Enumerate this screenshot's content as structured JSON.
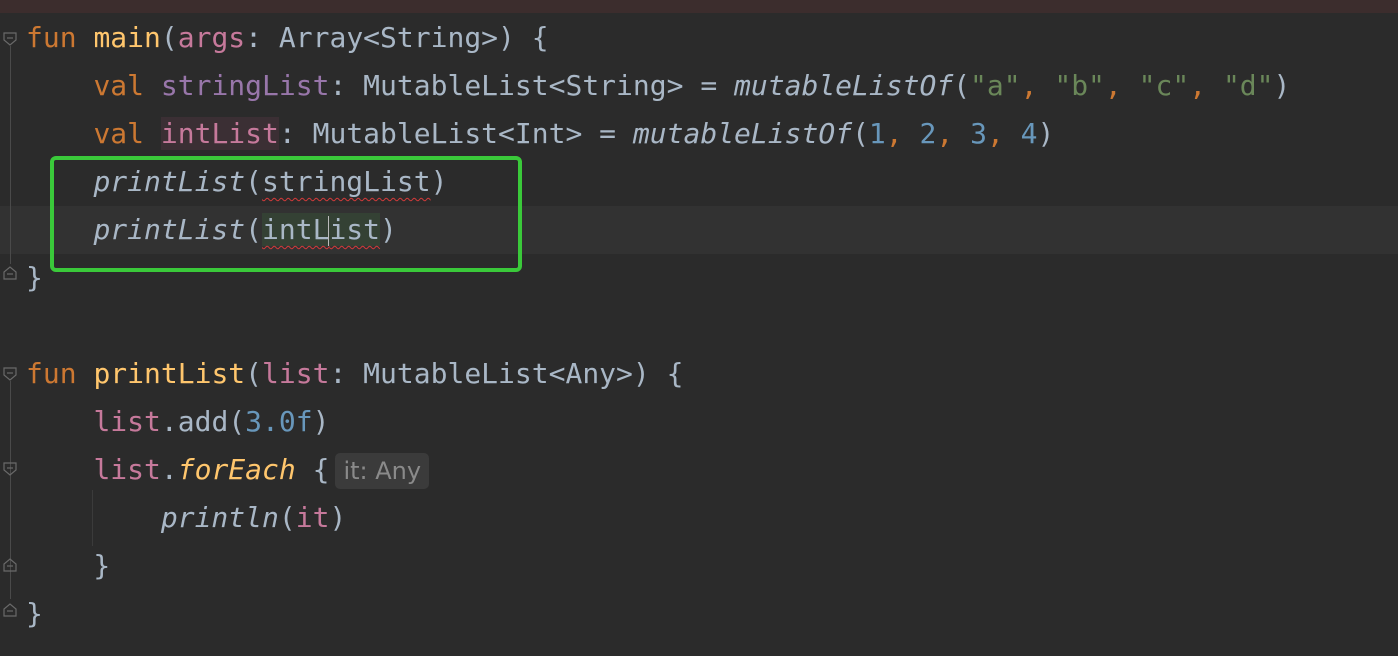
{
  "editor": {
    "lines": [
      {
        "tokens": [
          {
            "t": "fun",
            "c": "kw"
          },
          {
            "t": " ",
            "c": "plain"
          },
          {
            "t": "main",
            "c": "fn"
          },
          {
            "t": "(",
            "c": "plain"
          },
          {
            "t": "args",
            "c": "var"
          },
          {
            "t": ": Array<String>) {",
            "c": "plain"
          }
        ]
      },
      {
        "tokens": [
          {
            "t": "    ",
            "c": "plain"
          },
          {
            "t": "val",
            "c": "kw"
          },
          {
            "t": " ",
            "c": "plain"
          },
          {
            "t": "stringList",
            "c": "var2"
          },
          {
            "t": ": MutableList<String> = ",
            "c": "plain"
          },
          {
            "t": "mutableListOf",
            "c": "ital-fn"
          },
          {
            "t": "(",
            "c": "plain"
          },
          {
            "t": "\"a\"",
            "c": "str"
          },
          {
            "t": ", ",
            "c": "kw"
          },
          {
            "t": "\"b\"",
            "c": "str"
          },
          {
            "t": ", ",
            "c": "kw"
          },
          {
            "t": "\"c\"",
            "c": "str"
          },
          {
            "t": ", ",
            "c": "kw"
          },
          {
            "t": "\"d\"",
            "c": "str"
          },
          {
            "t": ")",
            "c": "plain"
          }
        ]
      },
      {
        "tokens": [
          {
            "t": "    ",
            "c": "plain"
          },
          {
            "t": "val",
            "c": "kw"
          },
          {
            "t": " ",
            "c": "plain"
          },
          {
            "t": "intList",
            "c": "pvar-bg"
          },
          {
            "t": ": MutableList<Int> = ",
            "c": "plain"
          },
          {
            "t": "mutableListOf",
            "c": "ital-fn"
          },
          {
            "t": "(",
            "c": "plain"
          },
          {
            "t": "1",
            "c": "num"
          },
          {
            "t": ", ",
            "c": "kw"
          },
          {
            "t": "2",
            "c": "num"
          },
          {
            "t": ", ",
            "c": "kw"
          },
          {
            "t": "3",
            "c": "num"
          },
          {
            "t": ", ",
            "c": "kw"
          },
          {
            "t": "4",
            "c": "num"
          },
          {
            "t": ")",
            "c": "plain"
          }
        ]
      },
      {
        "tokens": [
          {
            "t": "    ",
            "c": "plain"
          },
          {
            "t": "printList",
            "c": "ital-fn"
          },
          {
            "t": "(",
            "c": "plain"
          },
          {
            "t": "stringList",
            "c": "squiggle"
          },
          {
            "t": ")",
            "c": "plain"
          }
        ]
      },
      {
        "tokens": [
          {
            "t": "    ",
            "c": "plain"
          },
          {
            "t": "printList",
            "c": "ital-fn"
          },
          {
            "t": "(",
            "c": "plain"
          },
          {
            "t": "intL",
            "c": "squiggle-sel"
          },
          {
            "t": "|",
            "c": "caret"
          },
          {
            "t": "ist",
            "c": "squiggle-sel"
          },
          {
            "t": ")",
            "c": "plain"
          }
        ]
      },
      {
        "tokens": [
          {
            "t": "}",
            "c": "plain"
          }
        ]
      },
      {
        "tokens": []
      },
      {
        "tokens": [
          {
            "t": "fun",
            "c": "kw"
          },
          {
            "t": " ",
            "c": "plain"
          },
          {
            "t": "printList",
            "c": "fn"
          },
          {
            "t": "(",
            "c": "plain"
          },
          {
            "t": "list",
            "c": "var"
          },
          {
            "t": ": MutableList<Any>) {",
            "c": "plain"
          }
        ]
      },
      {
        "tokens": [
          {
            "t": "    ",
            "c": "plain"
          },
          {
            "t": "list",
            "c": "var"
          },
          {
            "t": ".add(",
            "c": "plain"
          },
          {
            "t": "3.0f",
            "c": "num"
          },
          {
            "t": ")",
            "c": "plain"
          }
        ]
      },
      {
        "tokens": [
          {
            "t": "    ",
            "c": "plain"
          },
          {
            "t": "list",
            "c": "var"
          },
          {
            "t": ".",
            "c": "plain"
          },
          {
            "t": "forEach",
            "c": "ital-call"
          },
          {
            "t": " {",
            "c": "plain"
          },
          {
            "t": "it: Any",
            "c": "hint"
          }
        ]
      },
      {
        "tokens": [
          {
            "t": "        ",
            "c": "plain"
          },
          {
            "t": "println",
            "c": "ital-fn"
          },
          {
            "t": "(",
            "c": "plain"
          },
          {
            "t": "it",
            "c": "var"
          },
          {
            "t": ")",
            "c": "plain"
          }
        ]
      },
      {
        "tokens": [
          {
            "t": "    }",
            "c": "plain"
          }
        ]
      },
      {
        "tokens": [
          {
            "t": "}",
            "c": "plain"
          }
        ]
      }
    ]
  },
  "colors": {
    "background": "#2b2b2b",
    "keyword": "#cc7832",
    "function_decl": "#ffc66d",
    "parameter": "#9876aa",
    "string": "#6a8759",
    "number": "#6897bb",
    "highlight_box": "#3ac93a",
    "error_squiggle": "#d43a3a"
  }
}
